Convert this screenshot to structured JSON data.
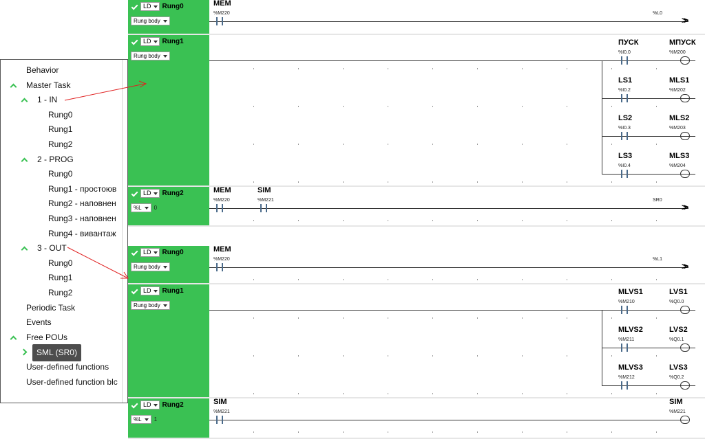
{
  "sections": [
    {
      "rungs": [
        {
          "lang": "LD",
          "name": "Rung0",
          "body": "Rung body",
          "value": "",
          "contacts": [
            {
              "label": "MEM",
              "addr": "%M220"
            }
          ],
          "output": {
            "kind": "jump",
            "label": "",
            "addr": "%L0"
          }
        },
        {
          "lang": "LD",
          "name": "Rung1",
          "body": "Rung body",
          "value": "",
          "branches": [
            {
              "contact": {
                "label": "ПУСК",
                "addr": "%I0.0"
              },
              "coil": {
                "label": "МПУСК",
                "addr": "%M200"
              }
            },
            {
              "contact": {
                "label": "LS1",
                "addr": "%I0.2"
              },
              "coil": {
                "label": "MLS1",
                "addr": "%M202"
              }
            },
            {
              "contact": {
                "label": "LS2",
                "addr": "%I0.3"
              },
              "coil": {
                "label": "MLS2",
                "addr": "%M203"
              }
            },
            {
              "contact": {
                "label": "LS3",
                "addr": "%I0.4"
              },
              "coil": {
                "label": "MLS3",
                "addr": "%M204"
              }
            }
          ]
        },
        {
          "lang": "LD",
          "name": "Rung2",
          "body": "%L",
          "value": "0",
          "contacts": [
            {
              "label": "MEM",
              "addr": "%M220"
            },
            {
              "label": "SIM",
              "addr": "%M221"
            }
          ],
          "output": {
            "kind": "jump",
            "label": "",
            "addr": "SR0"
          }
        }
      ]
    },
    {
      "rungs": [
        {
          "lang": "LD",
          "name": "Rung0",
          "body": "Rung body",
          "value": "",
          "contacts": [
            {
              "label": "MEM",
              "addr": "%M220"
            }
          ],
          "output": {
            "kind": "jump",
            "label": "",
            "addr": "%L1"
          }
        },
        {
          "lang": "LD",
          "name": "Rung1",
          "body": "Rung body",
          "value": "",
          "branches": [
            {
              "contact": {
                "label": "MLVS1",
                "addr": "%M210"
              },
              "coil": {
                "label": "LVS1",
                "addr": "%Q0.0"
              }
            },
            {
              "contact": {
                "label": "MLVS2",
                "addr": "%M211"
              },
              "coil": {
                "label": "LVS2",
                "addr": "%Q0.1"
              }
            },
            {
              "contact": {
                "label": "MLVS3",
                "addr": "%M212"
              },
              "coil": {
                "label": "LVS3",
                "addr": "%Q0.2"
              }
            }
          ]
        },
        {
          "lang": "LD",
          "name": "Rung2",
          "body": "%L",
          "value": "1",
          "contacts": [
            {
              "label": "SIM",
              "addr": "%M221"
            }
          ],
          "output": {
            "kind": "coil",
            "label": "SIM",
            "addr": "%M221"
          }
        }
      ]
    }
  ],
  "tree": {
    "items": [
      {
        "label": "Behavior",
        "level": 0,
        "expand": ""
      },
      {
        "label": "Master Task",
        "level": 0,
        "expand": "open"
      },
      {
        "label": "1 - IN",
        "level": 1,
        "expand": "open"
      },
      {
        "label": "Rung0",
        "level": 2,
        "expand": ""
      },
      {
        "label": "Rung1",
        "level": 2,
        "expand": ""
      },
      {
        "label": "Rung2",
        "level": 2,
        "expand": ""
      },
      {
        "label": "2 - PROG",
        "level": 1,
        "expand": "open"
      },
      {
        "label": "Rung0",
        "level": 2,
        "expand": ""
      },
      {
        "label": "Rung1 - простоюв",
        "level": 2,
        "expand": ""
      },
      {
        "label": "Rung2 - наповнен",
        "level": 2,
        "expand": ""
      },
      {
        "label": "Rung3 - наповнен",
        "level": 2,
        "expand": ""
      },
      {
        "label": "Rung4 - вивантаж",
        "level": 2,
        "expand": ""
      },
      {
        "label": "3 - OUT",
        "level": 1,
        "expand": "open"
      },
      {
        "label": "Rung0",
        "level": 2,
        "expand": ""
      },
      {
        "label": "Rung1",
        "level": 2,
        "expand": ""
      },
      {
        "label": "Rung2",
        "level": 2,
        "expand": ""
      },
      {
        "label": "Periodic Task",
        "level": 0,
        "expand": ""
      },
      {
        "label": "Events",
        "level": 0,
        "expand": ""
      },
      {
        "label": "Free POUs",
        "level": 0,
        "expand": "open"
      },
      {
        "label": "SML (SR0)",
        "level": 1,
        "expand": "closed",
        "selected": true
      },
      {
        "label": "User-defined functions",
        "level": 0,
        "expand": ""
      },
      {
        "label": "User-defined function blc",
        "level": 0,
        "expand": ""
      }
    ]
  },
  "accent_color": "#3ac153"
}
